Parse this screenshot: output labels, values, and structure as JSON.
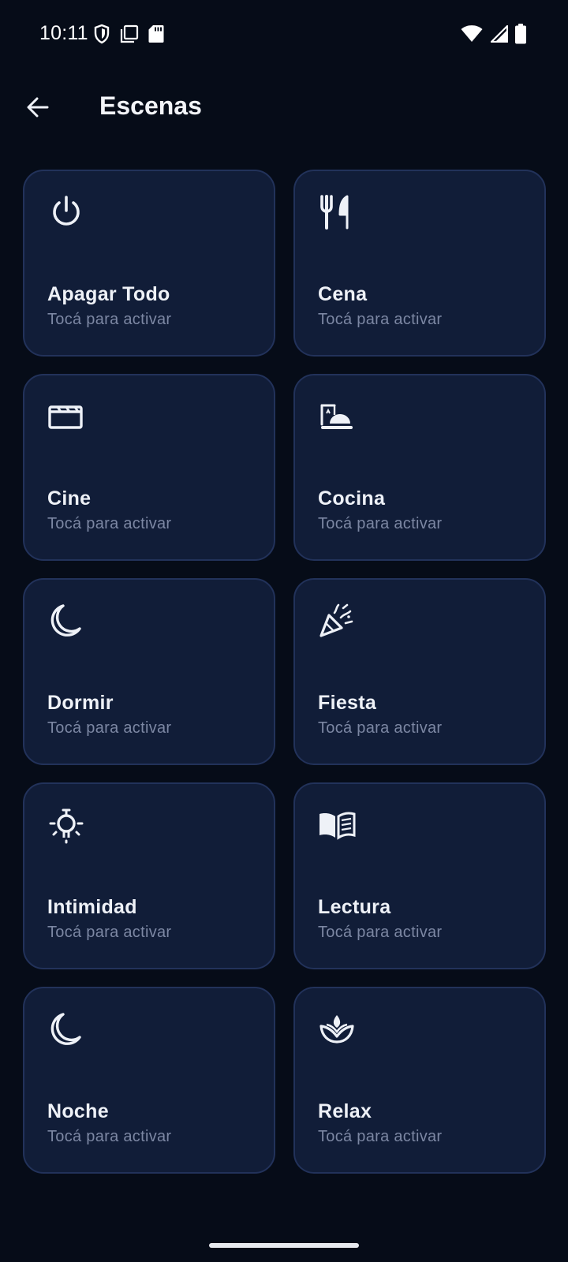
{
  "status_bar": {
    "time": "10:11",
    "left_icons": [
      "shield-icon",
      "screenshot-icon",
      "sd-card-icon"
    ],
    "right_icons": [
      "wifi-icon",
      "signal-icon",
      "battery-icon"
    ]
  },
  "app_bar": {
    "back_icon": "arrow-left-icon",
    "title": "Escenas"
  },
  "scenes": [
    {
      "icon": "power-icon",
      "title": "Apagar Todo",
      "subtitle": "Tocá para activar"
    },
    {
      "icon": "fork-knife-icon",
      "title": "Cena",
      "subtitle": "Tocá para activar"
    },
    {
      "icon": "clapperboard-icon",
      "title": "Cine",
      "subtitle": "Tocá para activar"
    },
    {
      "icon": "cooking-icon",
      "title": "Cocina",
      "subtitle": "Tocá para activar"
    },
    {
      "icon": "moon-icon",
      "title": "Dormir",
      "subtitle": "Tocá para activar"
    },
    {
      "icon": "party-popper-icon",
      "title": "Fiesta",
      "subtitle": "Tocá para activar"
    },
    {
      "icon": "lightbulb-icon",
      "title": "Intimidad",
      "subtitle": "Tocá para activar"
    },
    {
      "icon": "book-icon",
      "title": "Lectura",
      "subtitle": "Tocá para activar"
    },
    {
      "icon": "moon-icon",
      "title": "Noche",
      "subtitle": "Tocá para activar"
    },
    {
      "icon": "lotus-icon",
      "title": "Relax",
      "subtitle": "Tocá para activar"
    }
  ],
  "colors": {
    "background": "#060c18",
    "card": "#111d38",
    "card_border": "#22325a",
    "text_primary": "#eef1f7",
    "text_secondary": "#7c87a3"
  }
}
